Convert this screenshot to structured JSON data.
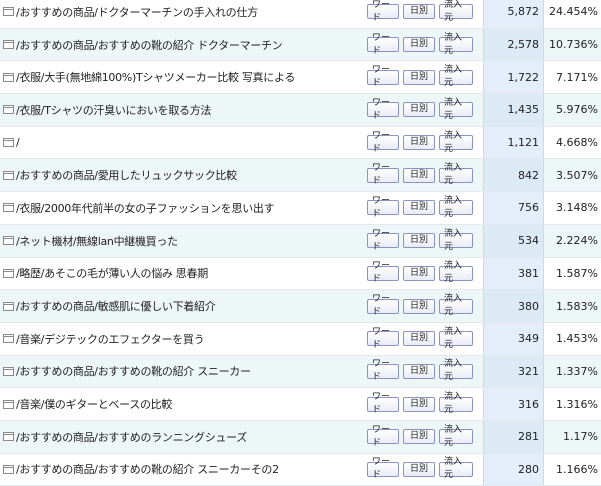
{
  "buttons": {
    "word": "ワード",
    "daily": "日別",
    "source": "流入元"
  },
  "rows": [
    {
      "path": "/おすすめの商品/ドクターマーチンの手入れの仕方",
      "count": "5,872",
      "pct": "24.454%"
    },
    {
      "path": "/おすすめの商品/おすすめの靴の紹介 ドクターマーチン",
      "count": "2,578",
      "pct": "10.736%"
    },
    {
      "path": "/衣服/大手(無地綿100%)Tシャツメーカー比較 写真による",
      "count": "1,722",
      "pct": "7.171%"
    },
    {
      "path": "/衣服/Tシャツの汗臭いにおいを取る方法",
      "count": "1,435",
      "pct": "5.976%"
    },
    {
      "path": "/",
      "count": "1,121",
      "pct": "4.668%"
    },
    {
      "path": "/おすすめの商品/愛用したリュックサック比較",
      "count": "842",
      "pct": "3.507%"
    },
    {
      "path": "/衣服/2000年代前半の女の子ファッションを思い出す",
      "count": "756",
      "pct": "3.148%"
    },
    {
      "path": "/ネット機材/無線lan中継機買った",
      "count": "534",
      "pct": "2.224%"
    },
    {
      "path": "/略歴/あそこの毛が薄い人の悩み 思春期",
      "count": "381",
      "pct": "1.587%"
    },
    {
      "path": "/おすすめの商品/敏感肌に優しい下着紹介",
      "count": "380",
      "pct": "1.583%"
    },
    {
      "path": "/音楽/デジテックのエフェクターを買う",
      "count": "349",
      "pct": "1.453%"
    },
    {
      "path": "/おすすめの商品/おすすめの靴の紹介 スニーカー",
      "count": "321",
      "pct": "1.337%"
    },
    {
      "path": "/音楽/僕のギターとベースの比較",
      "count": "316",
      "pct": "1.316%"
    },
    {
      "path": "/おすすめの商品/おすすめのランニングシューズ",
      "count": "281",
      "pct": "1.17%"
    },
    {
      "path": "/おすすめの商品/おすすめの靴の紹介 スニーカーその2",
      "count": "280",
      "pct": "1.166%"
    }
  ]
}
